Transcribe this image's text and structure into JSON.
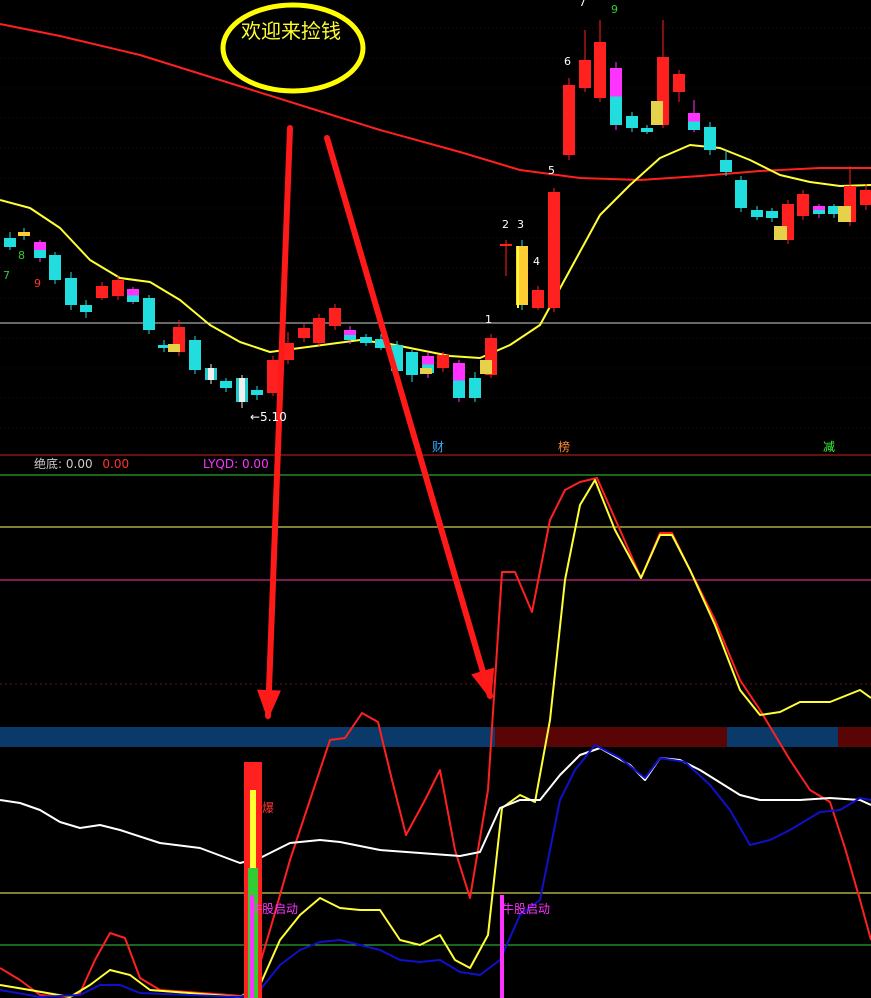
{
  "banner": {
    "text": "欢迎来捡钱"
  },
  "price_panel": {
    "wave_labels": [
      {
        "text": "7",
        "color": "#33cc33"
      },
      {
        "text": "8",
        "color": "#33cc33"
      },
      {
        "text": "9",
        "color": "#ff3333"
      },
      {
        "text": "1",
        "color": "#ffffff"
      },
      {
        "text": "2",
        "color": "#ffffff"
      },
      {
        "text": "3",
        "color": "#ffffff"
      },
      {
        "text": "4",
        "color": "#ffffff"
      },
      {
        "text": "5",
        "color": "#ffffff"
      },
      {
        "text": "6",
        "color": "#ffffff"
      },
      {
        "text": "7",
        "color": "#ffffff"
      },
      {
        "text": "9",
        "color": "#33cc33"
      }
    ],
    "low_marker": "←5.10",
    "event_tags": [
      {
        "text": "财",
        "color": "#33aaff"
      },
      {
        "text": "榜",
        "color": "#ff8833"
      },
      {
        "text": "减",
        "color": "#33ff33"
      }
    ]
  },
  "indicator_header": {
    "label1": "绝底:",
    "value1": "0.00",
    "value2": "0.00",
    "label3": "LYQD:",
    "value3": "0.00",
    "colors": {
      "label": "#cccccc",
      "value2": "#ff3333",
      "lyqd": "#ff33ff"
    }
  },
  "signals": {
    "burst": "爆",
    "start1": "牛股启动",
    "start2": "牛股启动"
  },
  "colors": {
    "up": "#ff2020",
    "down": "#22dddd",
    "ma_yellow": "#ffff33",
    "ma_red": "#ff2020",
    "white_line": "#ffffff",
    "blue_line": "#1010cc",
    "band_blue": "#0a3a6a",
    "band_red": "#5a0505",
    "magenta": "#ff33ff",
    "green_line": "#33cc33"
  }
}
